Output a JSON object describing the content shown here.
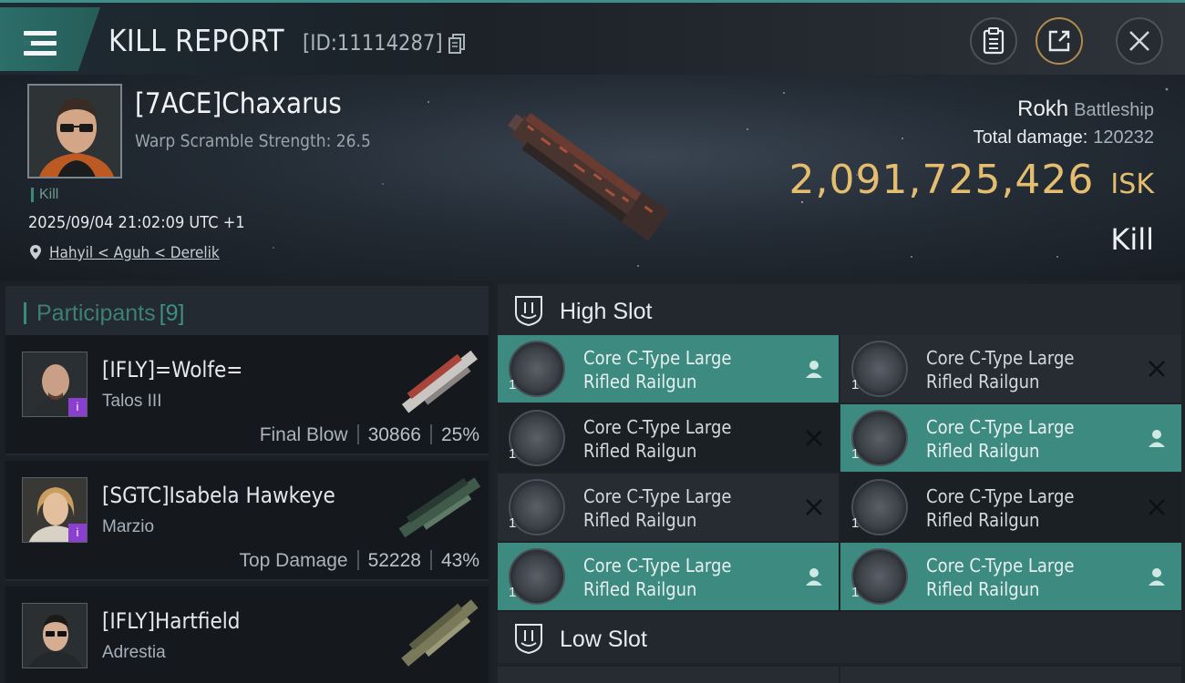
{
  "header": {
    "title": "KILL REPORT",
    "report_id": "[ID:11114287]"
  },
  "victim": {
    "name": "[7ACE]Chaxarus",
    "warp_scramble": "Warp Scramble Strength: 26.5",
    "tag": "Kill",
    "date": "2025/09/04 21:02:09 UTC +1",
    "location": "Hahyil < Aguh < Derelik",
    "ship_name": "Rokh",
    "ship_class": "Battleship",
    "total_damage_label": "Total damage:",
    "total_damage_value": "120232",
    "isk_value": "2,091,725,426",
    "isk_unit": "ISK",
    "outcome": "Kill"
  },
  "participants": {
    "label": "Participants",
    "count": "[9]",
    "items": [
      {
        "name": "[IFLY]=Wolfe=",
        "ship": "Talos III",
        "role": "Final Blow",
        "damage": "30866",
        "percent": "25%",
        "badge": "i"
      },
      {
        "name": "[SGTC]Isabela Hawkeye",
        "ship": "Marzio",
        "role": "Top Damage",
        "damage": "52228",
        "percent": "43%",
        "badge": "i"
      },
      {
        "name": "[IFLY]Hartfield",
        "ship": "Adrestia",
        "role": "",
        "damage": "",
        "percent": "",
        "badge": ""
      }
    ]
  },
  "slots": {
    "high": {
      "title": "High Slot",
      "modules": [
        {
          "name_line1": "Core C-Type Large",
          "name_line2": "Rifled Railgun",
          "qty": "1",
          "status": "dropped"
        },
        {
          "name_line1": "Core C-Type Large",
          "name_line2": "Rifled Railgun",
          "qty": "1",
          "status": "destroyed"
        },
        {
          "name_line1": "Core C-Type Large",
          "name_line2": "Rifled Railgun",
          "qty": "1",
          "status": "destroyed"
        },
        {
          "name_line1": "Core C-Type Large",
          "name_line2": "Rifled Railgun",
          "qty": "1",
          "status": "dropped"
        },
        {
          "name_line1": "Core C-Type Large",
          "name_line2": "Rifled Railgun",
          "qty": "1",
          "status": "destroyed"
        },
        {
          "name_line1": "Core C-Type Large",
          "name_line2": "Rifled Railgun",
          "qty": "1",
          "status": "destroyed"
        },
        {
          "name_line1": "Core C-Type Large",
          "name_line2": "Rifled Railgun",
          "qty": "1",
          "status": "dropped"
        },
        {
          "name_line1": "Core C-Type Large",
          "name_line2": "Rifled Railgun",
          "qty": "1",
          "status": "dropped"
        }
      ]
    },
    "low": {
      "title": "Low Slot"
    }
  },
  "icons": {
    "menu": "menu-icon",
    "copy": "copy-icon",
    "clipboard": "clipboard-icon",
    "share": "share-icon",
    "close": "close-icon",
    "location": "location-pin-icon",
    "dropped": "person-icon",
    "destroyed": "x-icon",
    "slot": "slot-shield-icon"
  },
  "colors": {
    "accent": "#3d8a80",
    "isk": "#e5bd6e",
    "badge": "#8a3fcf"
  }
}
